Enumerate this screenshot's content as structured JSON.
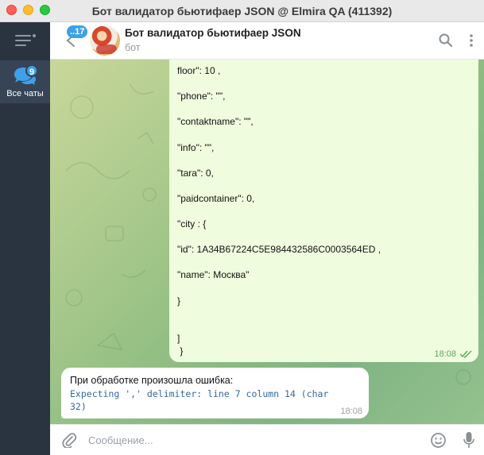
{
  "window": {
    "title": "Бот валидатор бьютифаер JSON @ Elmira QA (411392)"
  },
  "sidebar": {
    "folder_label": "Все чаты",
    "folder_unread": "9"
  },
  "header": {
    "back_badge": "17",
    "chat_name": "Бот валидатор бьютифаер JSON",
    "chat_status": "бот"
  },
  "messages": {
    "outgoing": {
      "lines": [
        "floor\": 10 ,",
        "\"phone\": \"\",",
        "\"contaktname\": \"\",",
        "\"info\": \"\",",
        "\"tara\": 0,",
        "\"paidcontainer\": 0,",
        "\"city : {",
        "\"id\": 1A34B67224C5E984432586C0003564ED ,",
        "\"name\": Москва\"",
        "}",
        "]",
        " }"
      ],
      "time": "18:08"
    },
    "incoming": {
      "title": "При обработке произошла ошибка:",
      "code": "Expecting ',' delimiter: line 7 column 14 (char 32)",
      "time": "18:08"
    }
  },
  "composer": {
    "placeholder": "Сообщение..."
  },
  "colors": {
    "accent": "#3fa0e8",
    "sidebar_bg": "#2a3441",
    "outgoing_bubble": "#effdde",
    "code_text": "#37689c"
  },
  "icons": [
    "menu-icon",
    "chats-folder-icon",
    "back-arrow-icon",
    "search-icon",
    "more-vertical-icon",
    "double-check-icon",
    "attach-icon",
    "emoji-icon",
    "microphone-icon"
  ]
}
